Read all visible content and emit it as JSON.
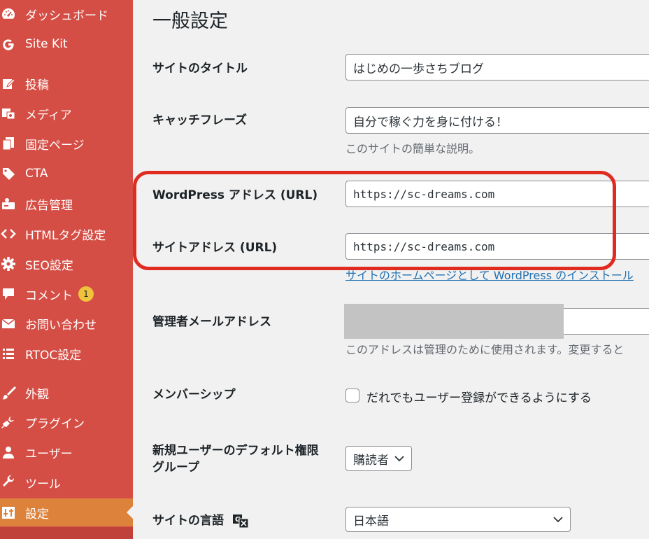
{
  "sidebar": {
    "items": [
      {
        "label": "ダッシュボード",
        "icon": "dashboard-icon"
      },
      {
        "label": "Site Kit",
        "icon": "sitekit-g-icon"
      },
      {
        "label": "投稿",
        "icon": "posts-icon"
      },
      {
        "label": "メディア",
        "icon": "media-icon"
      },
      {
        "label": "固定ページ",
        "icon": "pages-icon"
      },
      {
        "label": "CTA",
        "icon": "tag-icon"
      },
      {
        "label": "広告管理",
        "icon": "ads-icon"
      },
      {
        "label": "HTMLタグ設定",
        "icon": "code-icon"
      },
      {
        "label": "SEO設定",
        "icon": "gear-icon"
      },
      {
        "label": "コメント",
        "icon": "comment-icon",
        "badge": "1"
      },
      {
        "label": "お問い合わせ",
        "icon": "mail-icon"
      },
      {
        "label": "RTOC設定",
        "icon": "list-icon"
      },
      {
        "label": "外観",
        "icon": "brush-icon"
      },
      {
        "label": "プラグイン",
        "icon": "plugin-icon"
      },
      {
        "label": "ユーザー",
        "icon": "user-icon"
      },
      {
        "label": "ツール",
        "icon": "wrench-icon"
      },
      {
        "label": "設定",
        "icon": "settings-icon",
        "active": true
      }
    ]
  },
  "main": {
    "title": "一般設定",
    "site_title": {
      "label": "サイトのタイトル",
      "value": "はじめの一歩さちブログ"
    },
    "tagline": {
      "label": "キャッチフレーズ",
      "value": "自分で稼ぐ力を身に付ける！",
      "description": "このサイトの簡単な説明。"
    },
    "wp_address": {
      "label_main": "WordPress アドレス",
      "label_paren": "(URL)",
      "value": "https://sc-dreams.com"
    },
    "site_address": {
      "label_main": "サイトアドレス",
      "label_paren": "(URL)",
      "value": "https://sc-dreams.com",
      "description": "サイトのホームページとして WordPress のインストール"
    },
    "admin_email": {
      "label": "管理者メールアドレス",
      "description": "このアドレスは管理のために使用されます。変更すると"
    },
    "membership": {
      "label": "メンバーシップ",
      "checkbox_label": "だれでもユーザー登録ができるようにする"
    },
    "default_role": {
      "label_line1": "新規ユーザーのデフォルト権限",
      "label_line2": "グループ",
      "value": "購読者"
    },
    "language": {
      "label": "サイトの言語",
      "value": "日本語"
    }
  },
  "colors": {
    "sidebar_bg": "#d54e45",
    "active_item": "#dd823b",
    "badge": "#f0c33c",
    "highlight_border": "#e02b20",
    "link": "#2271b1"
  }
}
